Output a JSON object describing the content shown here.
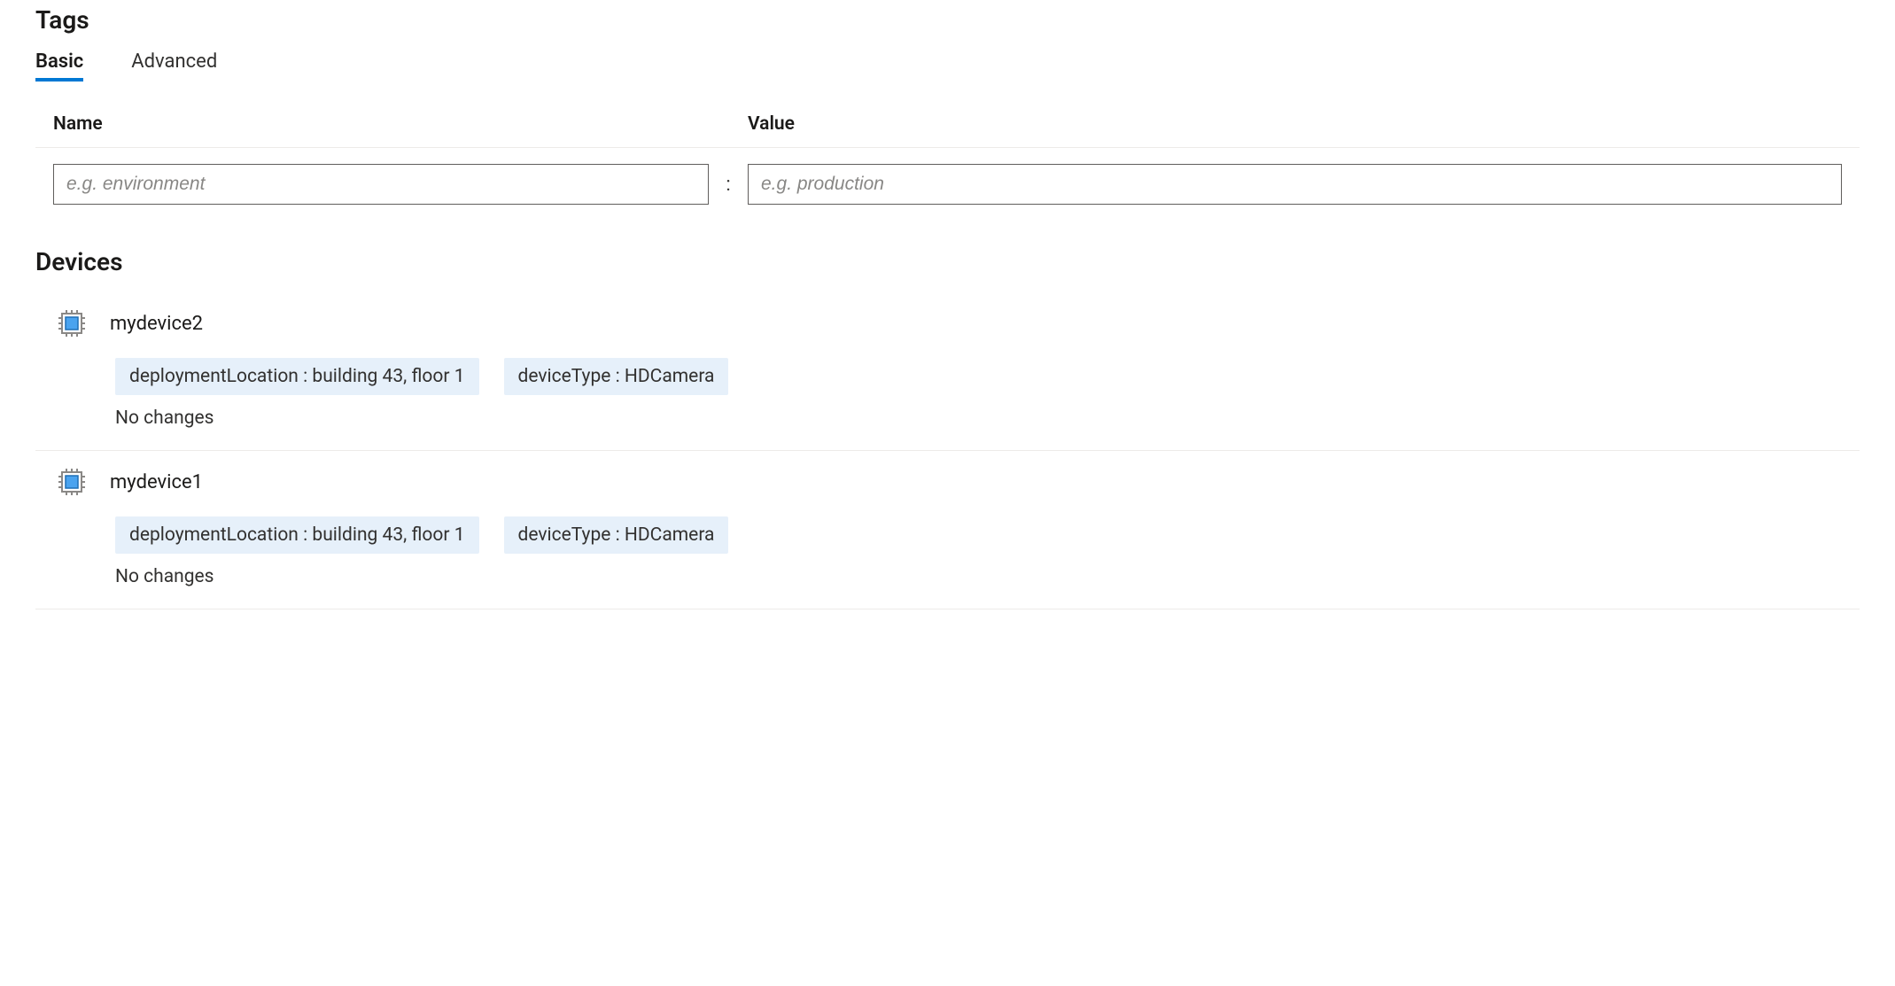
{
  "tags_section": {
    "title": "Tags",
    "tabs": [
      {
        "label": "Basic",
        "active": true
      },
      {
        "label": "Advanced",
        "active": false
      }
    ],
    "columns": {
      "name": "Name",
      "value": "Value",
      "separator": ":"
    },
    "input": {
      "name_placeholder": "e.g. environment",
      "value_placeholder": "e.g. production",
      "name_value": "",
      "value_value": ""
    }
  },
  "devices_section": {
    "title": "Devices",
    "items": [
      {
        "name": "mydevice2",
        "tags": [
          "deploymentLocation : building 43, floor 1",
          "deviceType : HDCamera"
        ],
        "status": "No changes"
      },
      {
        "name": "mydevice1",
        "tags": [
          "deploymentLocation : building 43, floor 1",
          "deviceType : HDCamera"
        ],
        "status": "No changes"
      }
    ]
  }
}
